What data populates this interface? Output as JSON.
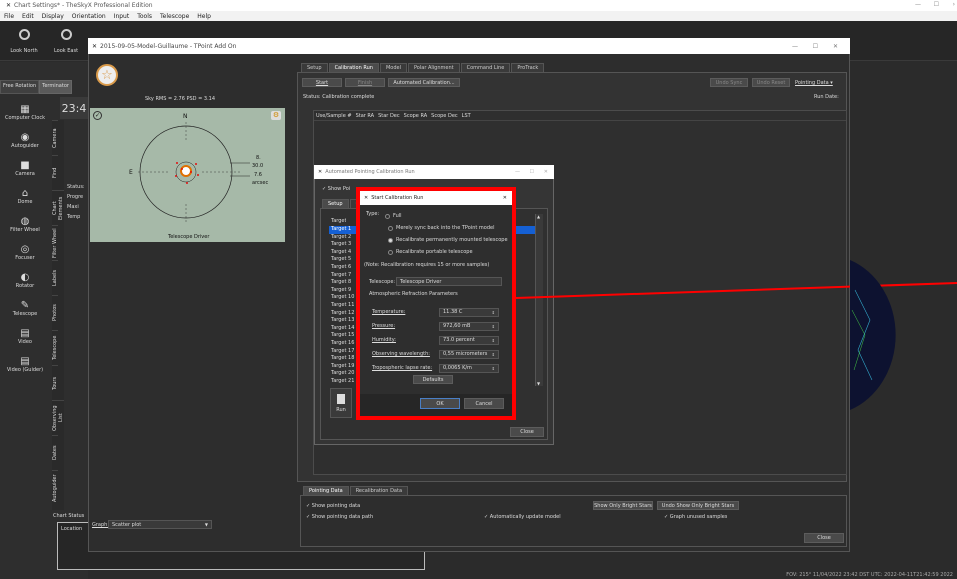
{
  "app": {
    "title": "Chart Settings* - TheSkyX Professional Edition",
    "menu": [
      "File",
      "Edit",
      "Display",
      "Orientation",
      "Input",
      "Tools",
      "Telescope",
      "Help"
    ],
    "toolbar": [
      {
        "label": "Look North",
        "icon": "look-north-icon"
      },
      {
        "label": "Look East",
        "icon": "look-east-icon"
      }
    ]
  },
  "left_panel": {
    "tabs": [
      "Free Rotation",
      "Terminator"
    ],
    "clock_time": "23:4",
    "items": [
      {
        "label": "Computer Clock",
        "icon": "clock-icon"
      },
      {
        "label": "Autoguider",
        "icon": "autoguider-icon"
      },
      {
        "label": "Camera",
        "icon": "camera-icon"
      },
      {
        "label": "Dome",
        "icon": "dome-icon"
      },
      {
        "label": "Filter Wheel",
        "icon": "filter-wheel-icon"
      },
      {
        "label": "Focuser",
        "icon": "focuser-icon"
      },
      {
        "label": "Rotator",
        "icon": "rotator-icon"
      },
      {
        "label": "Telescope",
        "icon": "telescope-icon"
      },
      {
        "label": "Video",
        "icon": "video-icon"
      },
      {
        "label": "Video (Guider)",
        "icon": "video-guider-icon"
      }
    ],
    "vertical_tabs": [
      "Camera",
      "Find",
      "Chart Elements",
      "Filter Wheel",
      "Labels",
      "Photos",
      "Telescope",
      "Tours",
      "Observing List",
      "Dates",
      "Autoguider"
    ],
    "status_labels": [
      "Status:",
      "Progre",
      "Maxi",
      "Temp"
    ],
    "chart_status": "Chart Status",
    "location": "Location"
  },
  "tpoint": {
    "title": "2015-09-05-Model-Guillaume - TPoint Add On",
    "sky_rms": "Sky RMS =  2.76    PSD =  3.14",
    "polar": {
      "north": "N",
      "east": "E",
      "scale_unit": "arcsec",
      "scale_labels": [
        "8.",
        "30.0",
        "7.6"
      ],
      "caption": "Telescope Driver"
    },
    "tabs": [
      "Setup",
      "Calibration Run",
      "Model",
      "Polar Alignment",
      "Command Line",
      "ProTrack"
    ],
    "active_tab": "Calibration Run",
    "buttons": {
      "start": "Start",
      "finish": "Finish",
      "auto": "Automated Calibration...",
      "undo_sync": "Undo Sync",
      "undo_reset": "Undo Reset",
      "pointing_data": "Pointing Data ▾"
    },
    "status": "Status: Calibration complete",
    "run_date": "Run Date:",
    "columns": [
      "Use/Sample #",
      "Star RA",
      "Star Dec",
      "Scope RA",
      "Scope Dec",
      "LST"
    ],
    "bottom_tabs": [
      "Pointing Data",
      "Recalibration Data"
    ],
    "show_pointing_data": "Show pointing data",
    "show_pointing_path": "Show pointing data path",
    "auto_update": "Automatically update model",
    "graph_unused": "Graph unused samples",
    "bright_only": "Show Only Bright Stars",
    "undo_bright": "Undo Show Only Bright Stars",
    "close": "Close",
    "graph_label": "Graph:",
    "graph_value": "Scatter plot"
  },
  "auto_dialog": {
    "title": "Automated Pointing Calibration Run",
    "show_label": "Show Poi",
    "tabs": [
      "Setup",
      "C"
    ],
    "target_header": "Target",
    "targets": [
      "Target 1",
      "Target 2",
      "Target 3",
      "Target 4",
      "Target 5",
      "Target 6",
      "Target 7",
      "Target 8",
      "Target 9",
      "Target 10",
      "Target 11",
      "Target 12",
      "Target 13",
      "Target 14",
      "Target 15",
      "Target 16",
      "Target 17",
      "Target 18",
      "Target 19",
      "Target 20",
      "Target 21"
    ],
    "selected_index": 0,
    "run": "Run",
    "close": "Close"
  },
  "start_dialog": {
    "title": "Start Calibration Run",
    "type_label": "Type:",
    "options": [
      "Full",
      "Merely sync back into the TPoint model",
      "Recalibrate permanently mounted telescope",
      "Recalibrate portable telescope"
    ],
    "selected_option": 2,
    "note": "(Note: Recalibration requires 15 or more samples)",
    "telescope_label": "Telescope:",
    "telescope_value": "Telescope Driver",
    "atmo_header": "Atmospheric Refraction Parameters",
    "fields": [
      {
        "label": "Temperature:",
        "value": "11.38 C"
      },
      {
        "label": "Pressure:",
        "value": "972,60 mB"
      },
      {
        "label": "Humidity:",
        "value": "73.0 percent"
      },
      {
        "label": "Observing wavelength:",
        "value": "0,55 micrometers"
      },
      {
        "label": "Tropospheric lapse rate:",
        "value": "0,0065 K/m"
      }
    ],
    "defaults": "Defaults",
    "ok": "OK",
    "cancel": "Cancel",
    "highlight_color": "#ff0000"
  },
  "statusbar": "FOV: 215°  11/04/2022  23:42 DST   UTC: 2022-04-11T21:42:59 2022"
}
